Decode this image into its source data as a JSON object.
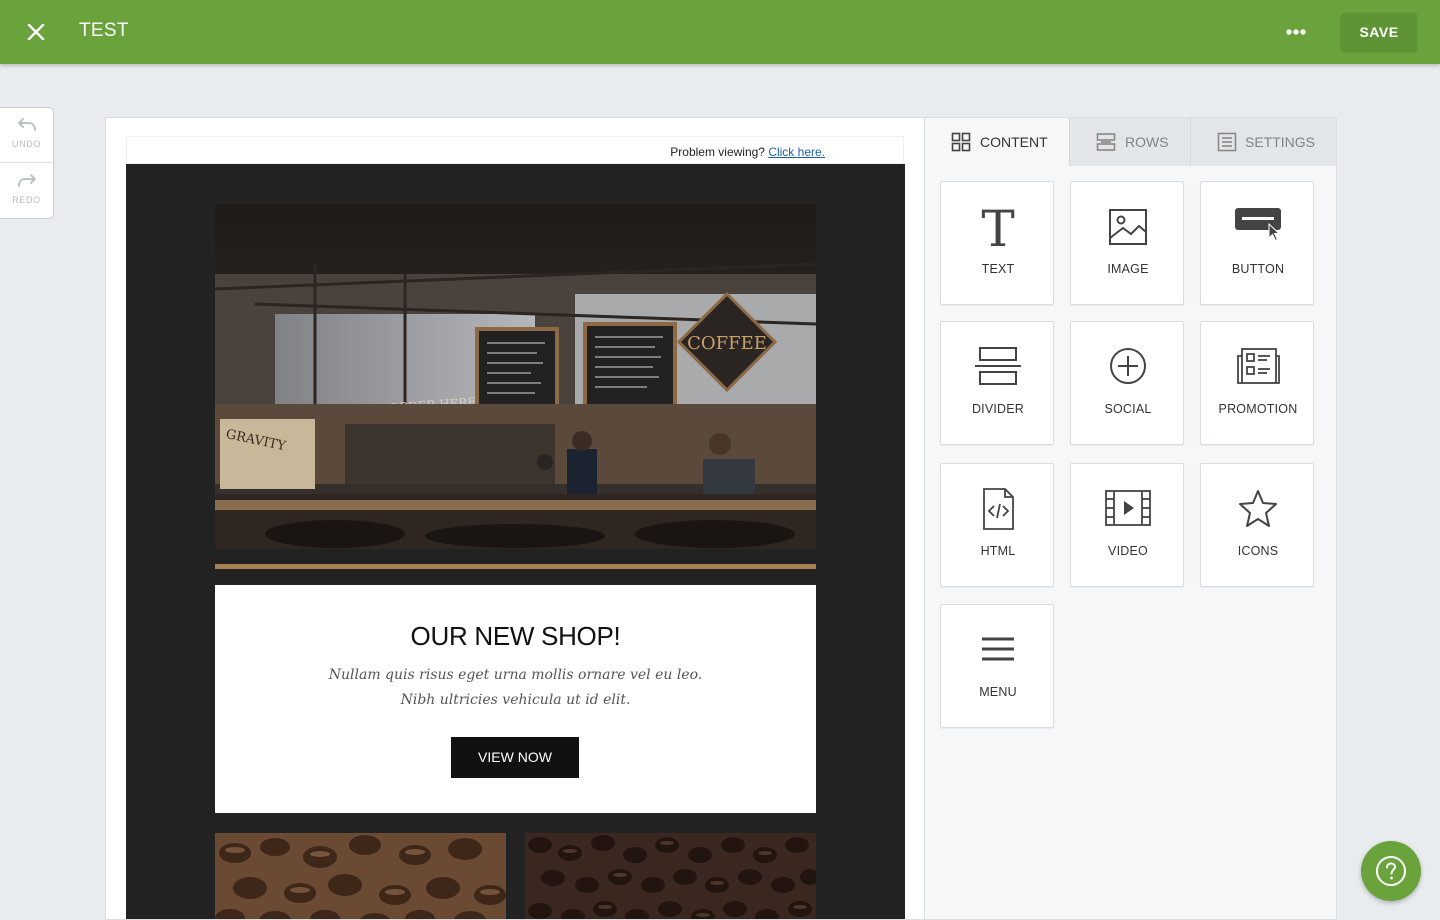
{
  "header": {
    "title": "TEST",
    "save_label": "SAVE",
    "close_icon": "close-icon",
    "more_icon": "more-dots-icon",
    "brand_color": "#6aa33b"
  },
  "history": {
    "undo_label": "UNDO",
    "redo_label": "REDO"
  },
  "email": {
    "preheader_text": "Problem viewing? ",
    "preheader_link": "Click here.",
    "headline": "OUR NEW SHOP!",
    "body_line_1": "Nullam quis risus eget urna mollis ornare vel eu leo.",
    "body_line_2": "Nibh ultricies vehicula ut id elit.",
    "cta_label": "VIEW NOW",
    "hero_sign_1": "COFFEE",
    "hero_sign_2": "ORDER HERE",
    "hero_sign_3": "GRAVITY"
  },
  "panel": {
    "tabs": [
      {
        "label": "CONTENT",
        "icon": "grid-icon",
        "active": true
      },
      {
        "label": "ROWS",
        "icon": "rows-icon",
        "active": false
      },
      {
        "label": "SETTINGS",
        "icon": "settings-list-icon",
        "active": false
      }
    ],
    "blocks": [
      {
        "label": "TEXT",
        "icon": "text-icon"
      },
      {
        "label": "IMAGE",
        "icon": "image-icon"
      },
      {
        "label": "BUTTON",
        "icon": "button-icon"
      },
      {
        "label": "DIVIDER",
        "icon": "divider-icon"
      },
      {
        "label": "SOCIAL",
        "icon": "social-plus-icon"
      },
      {
        "label": "PROMOTION",
        "icon": "promotion-icon"
      },
      {
        "label": "HTML",
        "icon": "html-code-icon"
      },
      {
        "label": "VIDEO",
        "icon": "video-icon"
      },
      {
        "label": "ICONS",
        "icon": "star-icon"
      },
      {
        "label": "MENU",
        "icon": "menu-icon"
      }
    ]
  },
  "help": {
    "icon": "help-question-icon"
  }
}
